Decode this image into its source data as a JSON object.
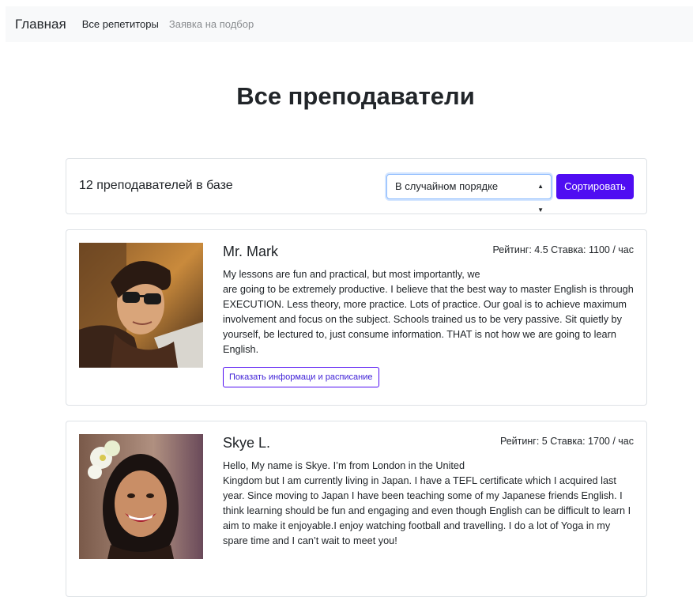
{
  "nav": {
    "brand": "Главная",
    "links": [
      "Все репетиторы",
      "Заявка на подбор"
    ]
  },
  "page": {
    "title": "Все преподаватели"
  },
  "filter": {
    "count_text": "12 преподавателей в базе",
    "sort_selected": "В случайном порядке",
    "sort_button": "Сортировать"
  },
  "tutors": [
    {
      "name": "Mr. Mark",
      "stats": "Рейтинг: 4.5 Ставка: 1100 / час",
      "desc_line1": "My lessons are fun and practical, but most importantly, we",
      "desc_rest": "are going to be extremely productive. I believe that the best way to master English is through EXECUTION. Less theory, more practice. Lots of practice. Our goal is to achieve maximum involvement and focus on the subject. Schools trained us to be very passive. Sit quietly by yourself, be lectured to, just consume information. THAT is not how we are going to learn English.",
      "button": "Показать информаци и расписание"
    },
    {
      "name": "Skye L.",
      "stats": "Рейтинг: 5 Ставка: 1700 / час",
      "desc_line1": "Hello, My name is Skye. I’m from London in the United",
      "desc_rest": "Kingdom but I am currently living in Japan. I have a TEFL certificate which I acquired last year. Since moving to Japan I have been teaching some of my Japanese friends English. I think learning should be fun and engaging and even though English can be difficult to learn I aim to make it enjoyable.I enjoy watching football and travelling. I do a lot of Yoga in my spare time and I can’t wait to meet you!"
    }
  ],
  "colors": {
    "accent": "#4f0df2",
    "navbar_bg": "#f8f9fa",
    "border": "#dee2e6"
  }
}
